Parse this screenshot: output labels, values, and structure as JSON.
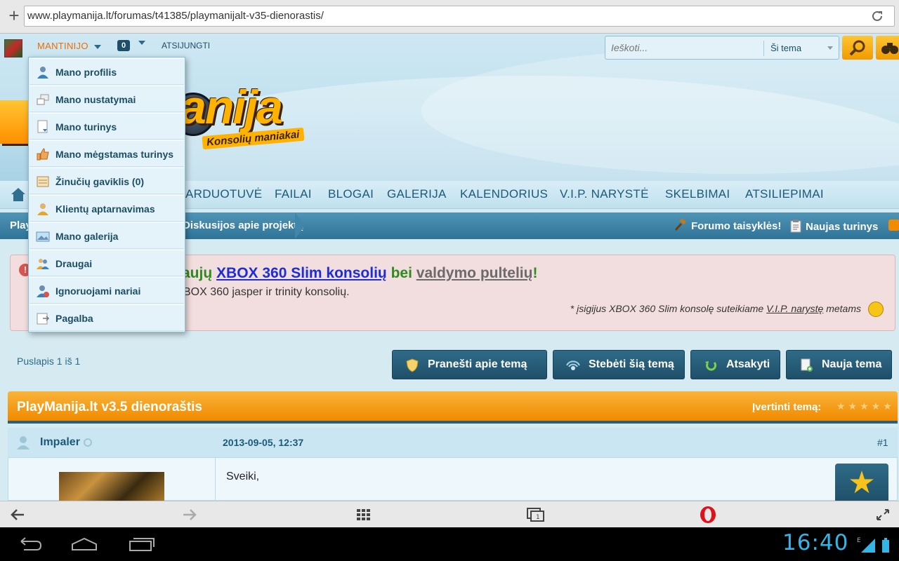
{
  "browser": {
    "url": "www.playmanija.lt/forumas/t41385/playmanijalt-v35-dienorastis/",
    "add_tab_icon": "plus-icon",
    "reload_icon": "reload-icon"
  },
  "userbar": {
    "username": "MANTINIJO",
    "notifications_count": "0",
    "logout": "ATSIJUNGTI"
  },
  "search": {
    "placeholder": "Ieškoti...",
    "scope": "Ši tema"
  },
  "logo": {
    "text": "anija",
    "tagline": "Konsolių maniakai"
  },
  "nav": {
    "items": [
      "ARDUOTUVĖ",
      "FAILAI",
      "BLOGAI",
      "GALERIJA",
      "KALENDORIUS",
      "V.I.P. NARYSTĖ",
      "SKELBIMAI",
      "ATSILIEPIMAI"
    ]
  },
  "breadcrumb": {
    "first": "Play",
    "current": "Diskusijos apie projektą",
    "rules": "Forumo taisyklės!",
    "new_content": "Naujas turinys"
  },
  "notice": {
    "line1_prefix": "aujų ",
    "line1_link1": "XBOX 360 Slim konsolių",
    "line1_mid": " bei ",
    "line1_link2": "valdymo pultelių",
    "line1_suffix": "!",
    "line2": "BOX 360 jasper ir trinity konsolių.",
    "line3_prefix": "* įsigijus XBOX 360 Slim konsolę suteikiame ",
    "line3_link": "V.I.P. narystę",
    "line3_suffix": " metams"
  },
  "pagination": {
    "text": "Puslapis 1 iš 1"
  },
  "actions": {
    "report": "Pranešti apie temą",
    "watch": "Stebėti šią temą",
    "reply": "Atsakyti",
    "new_topic": "Nauja tema"
  },
  "thread": {
    "title": "PlayManija.lt v3.5 dienoraštis",
    "rate_label": "Įvertinti temą:",
    "stars": "★★★★★"
  },
  "post": {
    "author": "Impaler",
    "date": "2013-09-05, 12:37",
    "number": "#1",
    "text": "Sveiki,",
    "badge": "★"
  },
  "user_menu": {
    "items": [
      {
        "label": "Mano profilis",
        "icon": "profile-icon"
      },
      {
        "label": "Mano nustatymai",
        "icon": "settings-icon"
      },
      {
        "label": "Mano turinys",
        "icon": "content-icon"
      },
      {
        "label": "Mano mėgstamas turinys",
        "icon": "thumbs-up-icon"
      },
      {
        "label": "Žinučių gaviklis (0)",
        "icon": "inbox-icon"
      },
      {
        "label": "Klientų aptarnavimas",
        "icon": "support-icon"
      },
      {
        "label": "Mano galerija",
        "icon": "gallery-icon"
      },
      {
        "label": "Draugai",
        "icon": "friends-icon"
      },
      {
        "label": "Ignoruojami nariai",
        "icon": "ignored-icon"
      },
      {
        "label": "Pagalba",
        "icon": "help-icon"
      }
    ]
  },
  "system": {
    "clock": "16:40"
  },
  "colors": {
    "accent_orange": "#f29a00",
    "nav_text": "#1b5a78",
    "breadcrumb_bg": "#2f7396",
    "clock": "#33b5e5"
  }
}
